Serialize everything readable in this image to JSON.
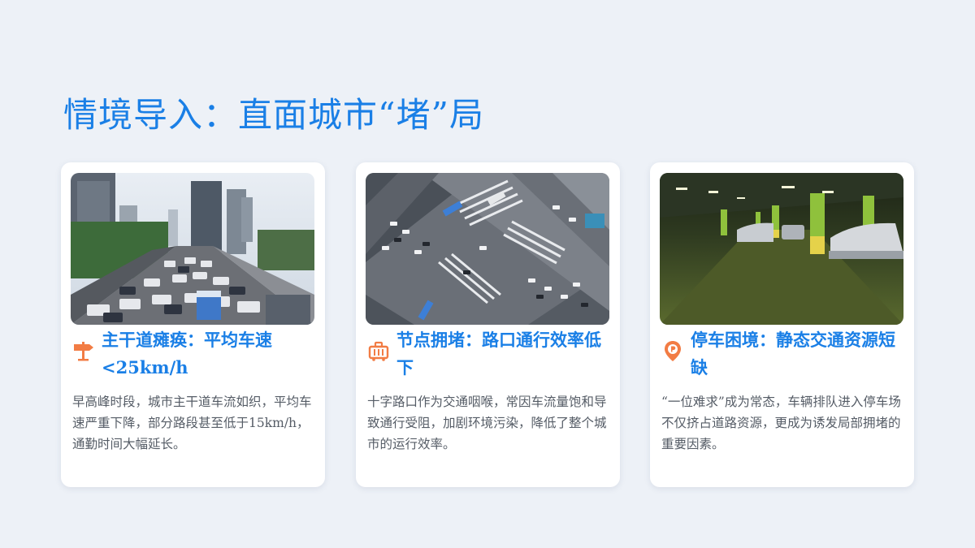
{
  "slide": {
    "title": "情境导入：直面城市“堵”局"
  },
  "cards": [
    {
      "icon": "signpost-icon",
      "image": "traffic-jam-photo",
      "title": "主干道瘫痪：平均车速<25km/h",
      "description": "早高峰时段，城市主干道车流如织，平均车速严重下降，部分路段甚至低于15km/h，通勤时间大幅延长。"
    },
    {
      "icon": "luggage-icon",
      "image": "intersection-aerial-photo",
      "title": "节点拥堵：路口通行效率低下",
      "description": "十字路口作为交通咽喉，常因车流量饱和导致通行受阻，加剧环境污染，降低了整个城市的运行效率。"
    },
    {
      "icon": "map-pin-parking-icon",
      "image": "parking-garage-photo",
      "title": "停车困境：静态交通资源短缺",
      "description": "“一位难求”成为常态，车辆排队进入停车场不仅挤占道路资源，更成为诱发局部拥堵的重要因素。"
    }
  ],
  "colors": {
    "accent": "#1a7fe6",
    "icon": "#f27c44",
    "background": "#edf1f7",
    "text": "#555c66"
  }
}
